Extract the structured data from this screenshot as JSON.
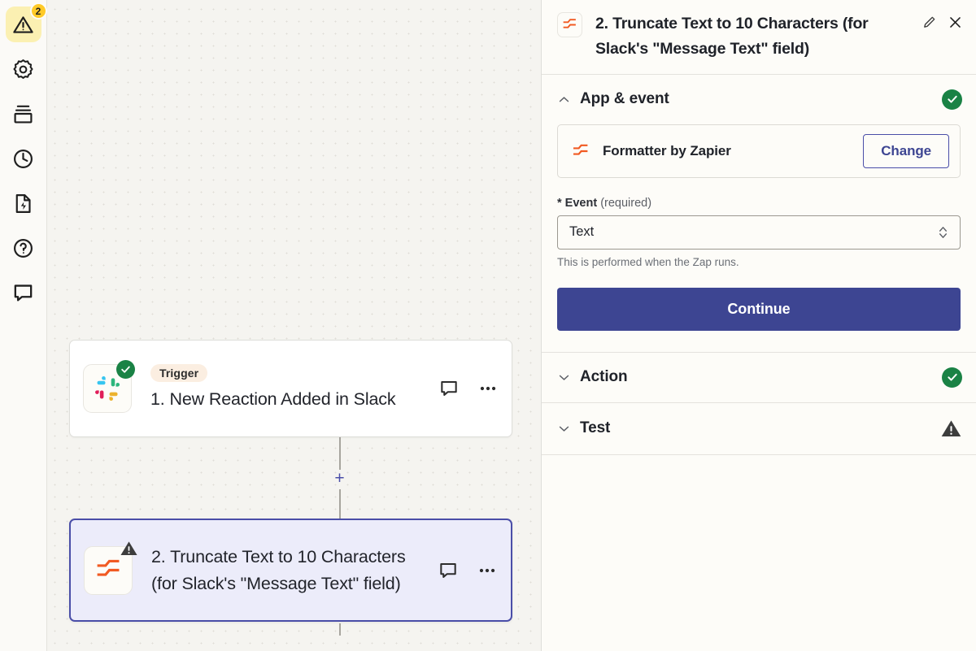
{
  "rail": {
    "items": [
      {
        "name": "alerts",
        "icon": "warning-triangle-icon",
        "badge": "2",
        "active": true
      },
      {
        "name": "settings",
        "icon": "gear-icon",
        "badge": null,
        "active": false
      },
      {
        "name": "versions",
        "icon": "layers-icon",
        "badge": null,
        "active": false
      },
      {
        "name": "history",
        "icon": "clock-icon",
        "badge": null,
        "active": false
      },
      {
        "name": "drafts",
        "icon": "file-bolt-icon",
        "badge": null,
        "active": false
      },
      {
        "name": "help",
        "icon": "question-circle-icon",
        "badge": null,
        "active": false
      },
      {
        "name": "comments",
        "icon": "speech-bubble-icon",
        "badge": null,
        "active": false
      }
    ]
  },
  "canvas": {
    "nodes": [
      {
        "id": "trigger",
        "pill": "Trigger",
        "title": "1. New Reaction Added in Slack",
        "app_icon": "slack-icon",
        "status": "ok",
        "selected": false,
        "comment_icon": "speech-bubble-icon",
        "more_icon": "ellipsis-icon"
      },
      {
        "id": "action",
        "pill": null,
        "title": "2. Truncate Text to 10 Characters (for Slack's \"Message Text\" field)",
        "app_icon": "formatter-icon",
        "status": "warning",
        "selected": true,
        "comment_icon": "speech-bubble-icon",
        "more_icon": "ellipsis-icon"
      }
    ],
    "add_step_label": "+"
  },
  "panel": {
    "header": {
      "app_icon": "formatter-icon",
      "title": "2. Truncate Text to 10 Characters (for Slack's \"Message Text\" field)",
      "edit_icon": "pencil-icon",
      "close_icon": "close-icon"
    },
    "sections": [
      {
        "id": "app-event",
        "title": "App & event",
        "expanded": true,
        "status": "ok",
        "chevron": "chevron-up-icon"
      },
      {
        "id": "action",
        "title": "Action",
        "expanded": false,
        "status": "ok",
        "chevron": "chevron-down-icon"
      },
      {
        "id": "test",
        "title": "Test",
        "expanded": false,
        "status": "warning",
        "chevron": "chevron-down-icon"
      }
    ],
    "app_event": {
      "app_name": "Formatter by Zapier",
      "app_icon": "formatter-icon",
      "change_label": "Change",
      "event_label": "Event",
      "event_required_suffix": "(required)",
      "event_value": "Text",
      "event_help": "This is performed when the Zap runs.",
      "continue_label": "Continue"
    }
  },
  "colors": {
    "accent_indigo": "#3d4592",
    "success_green": "#1a8245",
    "warn_amber": "#ffca28",
    "formatter_orange": "#f15a22",
    "selected_node_bg": "#ececfa",
    "pill_bg": "#fbeee1"
  }
}
